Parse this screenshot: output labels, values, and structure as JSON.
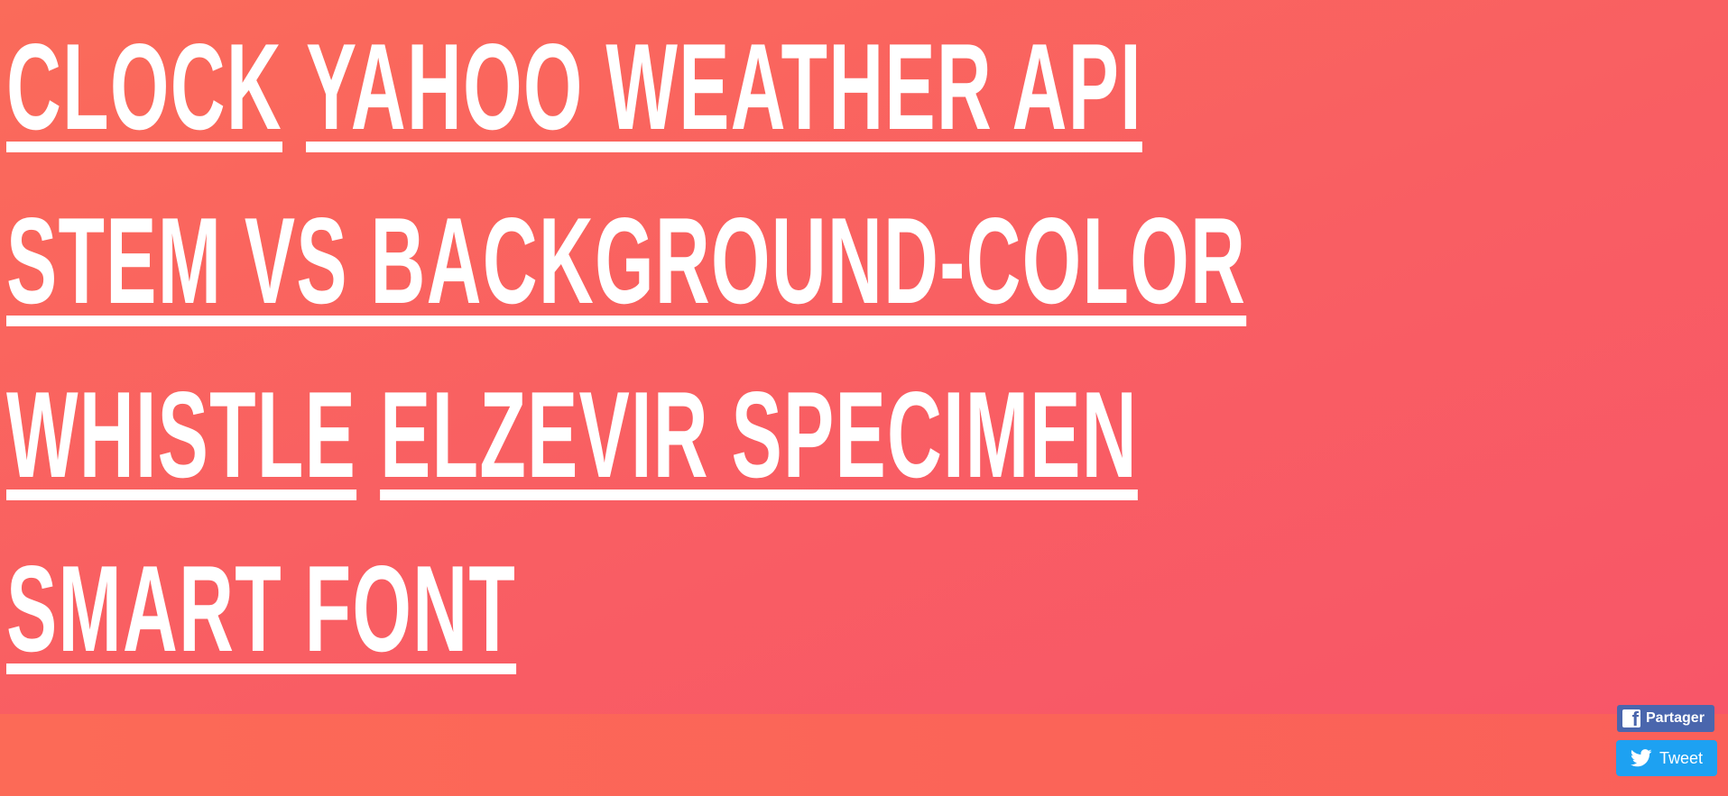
{
  "links": [
    [
      "CLOCK",
      "YAHOO WEATHER API"
    ],
    [
      "STEM VS BACKGROUND-COLOR"
    ],
    [
      "WHISTLE",
      "ELZEVIR SPECIMEN"
    ],
    [
      "SMART FONT"
    ]
  ],
  "share": {
    "facebook_label": "Partager",
    "twitter_label": "Tweet"
  },
  "colors": {
    "background_top": "#fa6b5a",
    "background_bottom": "#f85668",
    "facebook": "#4a66ad",
    "twitter": "#1da1f2",
    "text": "#ffffff"
  },
  "icons": [
    "facebook-icon",
    "twitter-icon"
  ]
}
